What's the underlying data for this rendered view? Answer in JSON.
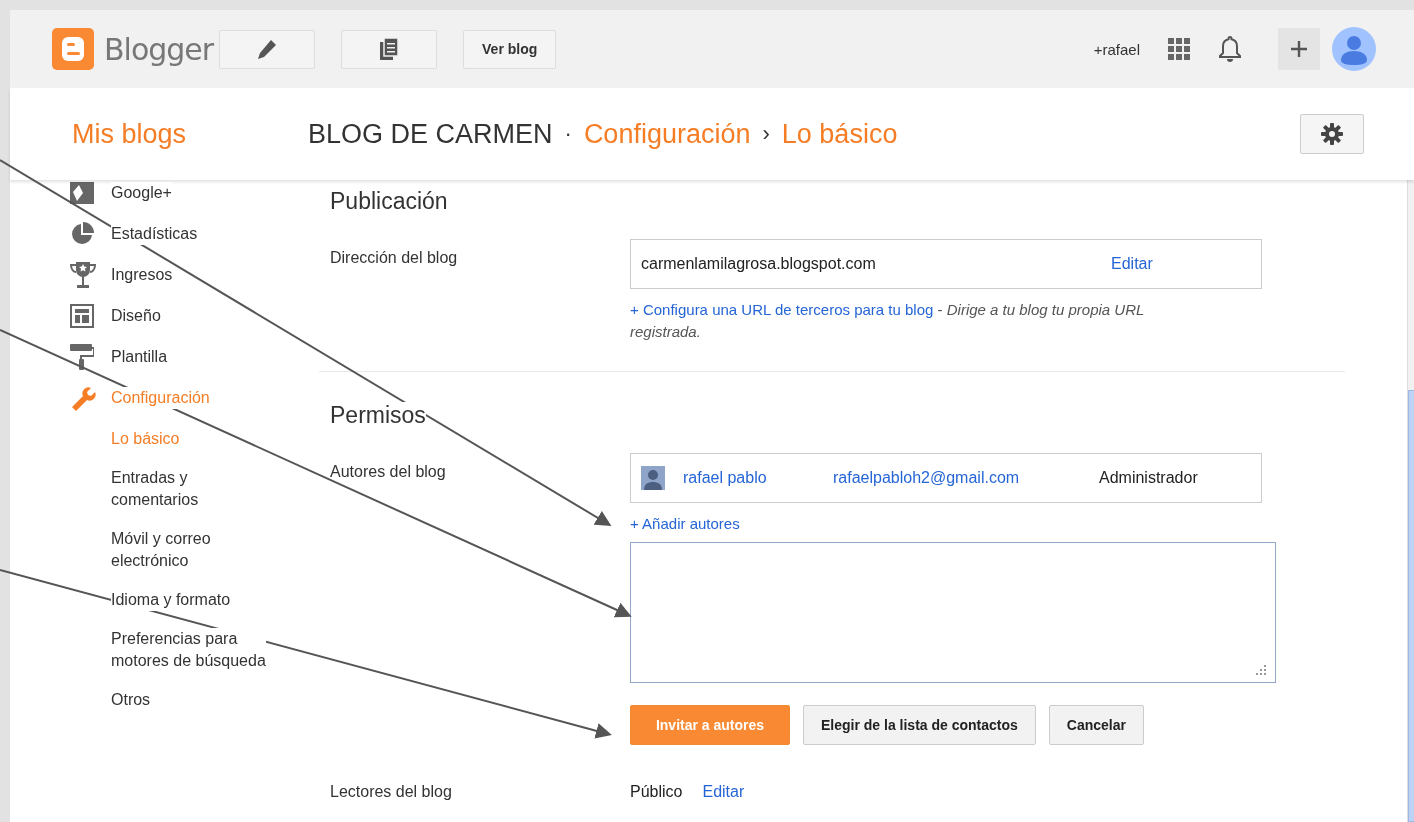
{
  "header": {
    "logo": "Blogger",
    "view_blog_button": "Ver blog",
    "user": "+rafael"
  },
  "subheader": {
    "my_blogs": "Mis blogs",
    "blog_name": "BLOG DE CARMEN",
    "separator": "·",
    "section": "Configuración",
    "chevron": "›",
    "page": "Lo básico"
  },
  "sidebar": [
    {
      "label": "Google+",
      "selected": false
    },
    {
      "label": "Estadísticas",
      "selected": false
    },
    {
      "label": "Ingresos",
      "selected": false
    },
    {
      "label": "Diseño",
      "selected": false
    },
    {
      "label": "Plantilla",
      "selected": false
    },
    {
      "label": "Configuración",
      "selected": true,
      "children": [
        {
          "label": "Lo básico",
          "selected": true
        },
        {
          "label": "Entradas y\ncomentarios",
          "selected": false
        },
        {
          "label": "Móvil y correo\nelectrónico",
          "selected": false
        },
        {
          "label": "Idioma y formato",
          "selected": false
        },
        {
          "label": "Preferencias para\nmotores de búsqueda",
          "selected": false
        },
        {
          "label": "Otros",
          "selected": false
        }
      ]
    }
  ],
  "publishing": {
    "title": "Publicación",
    "address_label": "Dirección del blog",
    "address": "carmenlamilagrosa.blogspot.com",
    "edit": "Editar",
    "custom_url_link": "+ Configura una URL de terceros para tu blog",
    "custom_url_note": "- *Dirige a tu blog tu propia URL registrada.*"
  },
  "permissions": {
    "title": "Permisos",
    "authors_label": "Autores del blog",
    "authors": [
      {
        "name": "rafael pablo",
        "email": "rafaelpabloh2@gmail.com",
        "role": "Administrador"
      }
    ],
    "add_authors": "+ Añadir autores",
    "invite_button": "Invitar a autores",
    "contacts_button": "Elegir de la lista de contactos",
    "cancel_button": "Cancelar",
    "readers_label": "Lectores del blog",
    "readers_value": "Público",
    "readers_edit": "Editar"
  }
}
